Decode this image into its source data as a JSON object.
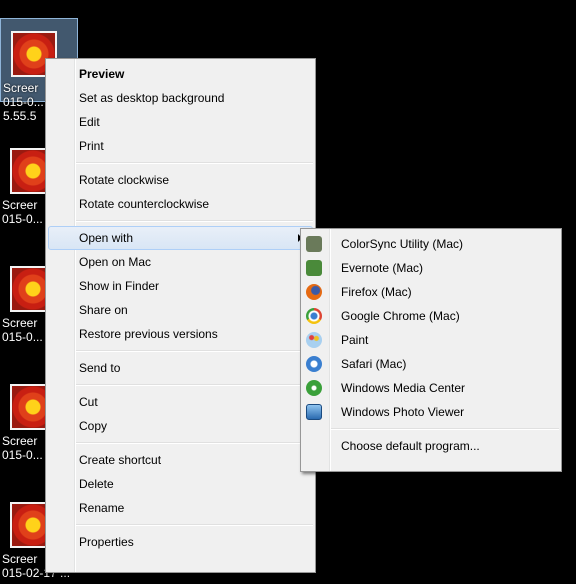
{
  "desktop": {
    "icons": [
      {
        "label": "Screer\n015-0...\n5.55.5"
      },
      {
        "label": "Screer\n015-0..."
      },
      {
        "label": "Screer\n015-0..."
      },
      {
        "label": "Screer\n015-0..."
      },
      {
        "label": "Screer\n015-02-17 ..."
      }
    ]
  },
  "context_menu": {
    "preview": "Preview",
    "set_background": "Set as desktop background",
    "edit": "Edit",
    "print": "Print",
    "rotate_cw": "Rotate clockwise",
    "rotate_ccw": "Rotate counterclockwise",
    "open_with": "Open with",
    "open_on_mac": "Open on Mac",
    "show_in_finder": "Show in Finder",
    "share_on": "Share on",
    "restore_versions": "Restore previous versions",
    "send_to": "Send to",
    "cut": "Cut",
    "copy": "Copy",
    "create_shortcut": "Create shortcut",
    "delete": "Delete",
    "rename": "Rename",
    "properties": "Properties"
  },
  "open_with_menu": {
    "items": [
      {
        "label": "ColorSync Utility (Mac)",
        "icon": "colorsync-icon",
        "color": "#6a7a5a"
      },
      {
        "label": "Evernote (Mac)",
        "icon": "evernote-icon",
        "color": "#4a8a3a"
      },
      {
        "label": "Firefox (Mac)",
        "icon": "firefox-icon",
        "color": "#e66a12"
      },
      {
        "label": "Google Chrome (Mac)",
        "icon": "chrome-icon",
        "color": "#dd4433"
      },
      {
        "label": "Paint",
        "icon": "paint-icon",
        "color": "#5aa0d8"
      },
      {
        "label": "Safari (Mac)",
        "icon": "safari-icon",
        "color": "#3a7fd0"
      },
      {
        "label": "Windows Media Center",
        "icon": "media-center-icon",
        "color": "#3aa03a"
      },
      {
        "label": "Windows Photo Viewer",
        "icon": "photo-viewer-icon",
        "color": "#2a6ab0"
      }
    ],
    "choose_default": "Choose default program..."
  }
}
